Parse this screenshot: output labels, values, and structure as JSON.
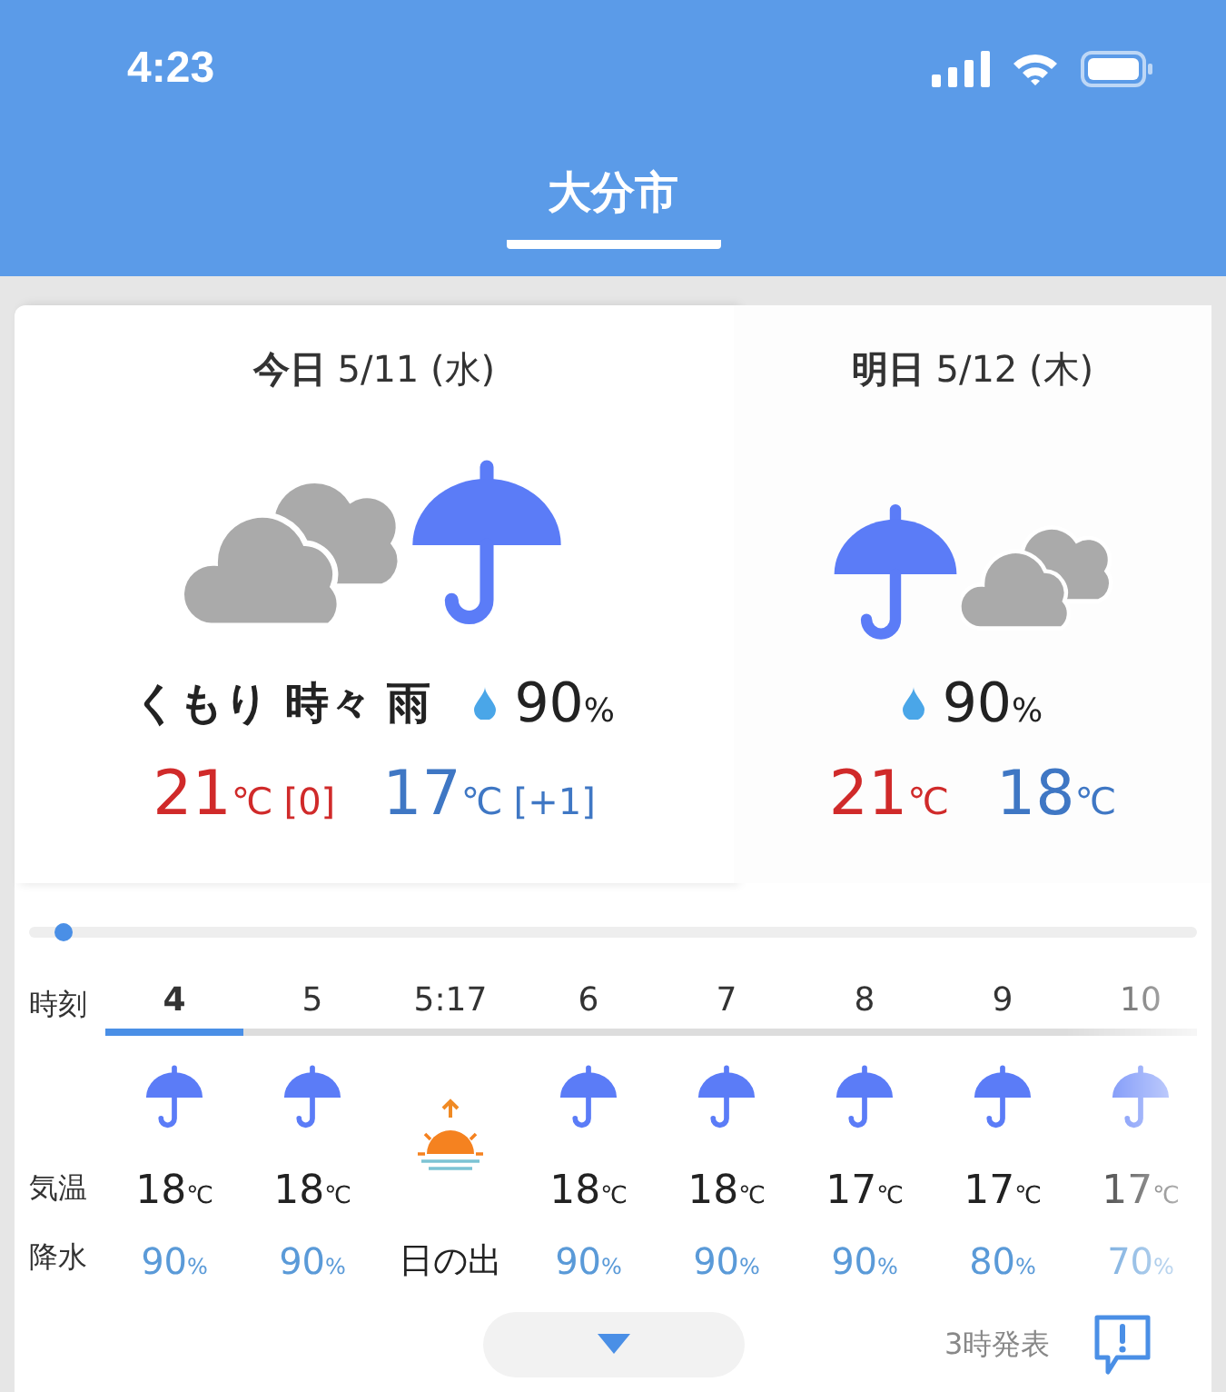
{
  "status_bar": {
    "time": "4:23"
  },
  "header": {
    "title": "大分市"
  },
  "days": [
    {
      "label": "今日",
      "date": "5/11 (水)",
      "selected": true,
      "kind": "cloudrain",
      "weather": "くもり 時々 雨",
      "rain_chance": "90",
      "rain_unit": "%",
      "high": "21",
      "high_unit": "℃",
      "high_diff": "[0]",
      "low": "17",
      "low_unit": "℃",
      "low_diff": "[+1]"
    },
    {
      "label": "明日",
      "date": "5/12 (木)",
      "selected": false,
      "kind": "raincloud",
      "rain_chance": "90",
      "rain_unit": "%",
      "high": "21",
      "high_unit": "℃",
      "low": "18",
      "low_unit": "℃"
    }
  ],
  "timeline": {
    "level": 0.03
  },
  "hourly": {
    "row_labels": [
      "時刻",
      "気温",
      "降水"
    ],
    "hours": [
      {
        "time": "4",
        "selected": true,
        "kind": "rain",
        "temp": "18",
        "temp_unit": "℃",
        "precip": "90",
        "precip_unit": "%"
      },
      {
        "time": "5",
        "selected": false,
        "kind": "rain",
        "temp": "18",
        "temp_unit": "℃",
        "precip": "90",
        "precip_unit": "%"
      },
      {
        "time": "5:17",
        "selected": false,
        "kind": "sunrise",
        "note": "日の出"
      },
      {
        "time": "6",
        "selected": false,
        "kind": "rain",
        "temp": "18",
        "temp_unit": "℃",
        "precip": "90",
        "precip_unit": "%"
      },
      {
        "time": "7",
        "selected": false,
        "kind": "rain",
        "temp": "18",
        "temp_unit": "℃",
        "precip": "90",
        "precip_unit": "%"
      },
      {
        "time": "8",
        "selected": false,
        "kind": "rain",
        "temp": "17",
        "temp_unit": "℃",
        "precip": "90",
        "precip_unit": "%"
      },
      {
        "time": "9",
        "selected": false,
        "kind": "rain",
        "temp": "17",
        "temp_unit": "℃",
        "precip": "80",
        "precip_unit": "%"
      },
      {
        "time": "10",
        "selected": false,
        "kind": "rain",
        "temp": "17",
        "temp_unit": "℃",
        "precip": "70",
        "precip_unit": "%"
      }
    ]
  },
  "footer": {
    "issued": "3時発表"
  }
}
